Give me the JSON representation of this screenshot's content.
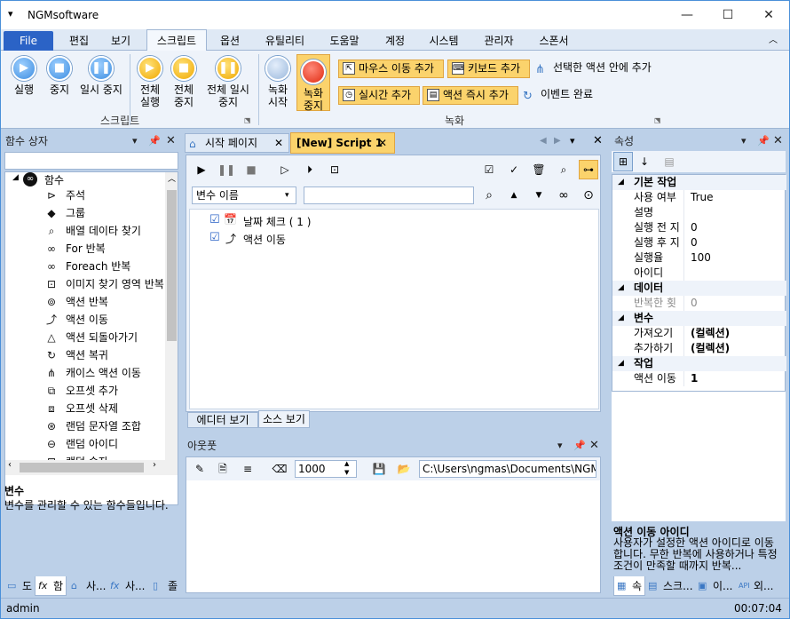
{
  "window": {
    "title": "NGMsoftware"
  },
  "menu": {
    "file": "File",
    "items": [
      "편집",
      "보기",
      "스크립트",
      "옵션",
      "유틸리티",
      "도움말",
      "계정",
      "시스템",
      "관리자",
      "스폰서"
    ]
  },
  "ribbon": {
    "run": "실행",
    "stop": "중지",
    "pause": "일시 중지",
    "run_all": "전체 실행",
    "stop_all": "전체 중지",
    "pause_all": "전체 일시 중지",
    "rec_start": "녹화 시작",
    "rec_stop": "녹화 중지",
    "mouse_move": "마우스 이동 추가",
    "keyboard": "키보드 추가",
    "in_action": "선택한 액션 안에 추가",
    "realtime": "실시간 추가",
    "action_now": "액션 즉시 추가",
    "event_done": "이벤트 완료",
    "group_script": "스크립트",
    "group_record": "녹화"
  },
  "left_panel": {
    "title": "함수 상자",
    "root": "함수",
    "items": [
      {
        "icon": "comment-icon",
        "label": "주석"
      },
      {
        "icon": "group-icon",
        "label": "그룹"
      },
      {
        "icon": "search-icon",
        "label": "배열 데이타 찾기"
      },
      {
        "icon": "infinity-icon",
        "label": "For 반복"
      },
      {
        "icon": "infinity-icon",
        "label": "Foreach 반복"
      },
      {
        "icon": "image-find-icon",
        "label": "이미지 찾기 영역 반복"
      },
      {
        "icon": "loop-icon",
        "label": "액션 반복"
      },
      {
        "icon": "jump-icon",
        "label": "액션 이동"
      },
      {
        "icon": "back-icon",
        "label": "액션 되돌아가기"
      },
      {
        "icon": "restore-icon",
        "label": "액션 복귀"
      },
      {
        "icon": "case-icon",
        "label": "캐이스 액션 이동"
      },
      {
        "icon": "offset-add-icon",
        "label": "오프셋 추가"
      },
      {
        "icon": "offset-delete-icon",
        "label": "오프셋 삭제"
      },
      {
        "icon": "random-string-icon",
        "label": "랜덤 문자열 조합"
      },
      {
        "icon": "random-id-icon",
        "label": "랜덤 아이디"
      },
      {
        "icon": "random-number-icon",
        "label": "랜덤 숫자"
      }
    ],
    "desc_title": "변수",
    "desc_text": "변수를 관리할 수 있는 함수들입니다.",
    "bottom_tabs": [
      "도",
      "함",
      "사...",
      "사...",
      "졸"
    ]
  },
  "editor": {
    "tabs": [
      {
        "label": "시작 페이지"
      },
      {
        "label": "[New] Script 1"
      }
    ],
    "var_select": "변수 이름",
    "tree": [
      {
        "label": "날짜 체크 ( 1 )"
      },
      {
        "label": "액션 이동"
      }
    ],
    "bottom_tabs": [
      "에디터 보기",
      "소스 보기"
    ]
  },
  "output": {
    "title": "아웃풋",
    "number": "1000",
    "path": "C:\\Users\\ngmas\\Documents\\NGM6\\"
  },
  "properties": {
    "title": "속성",
    "categories": [
      {
        "name": "기본 작업",
        "rows": [
          {
            "k": "사용 여부",
            "v": "True"
          },
          {
            "k": "설명",
            "v": ""
          },
          {
            "k": "실행 전 지",
            "v": "0"
          },
          {
            "k": "실행 후 지",
            "v": "0"
          },
          {
            "k": "실행율",
            "v": "100"
          },
          {
            "k": "아이디",
            "v": ""
          }
        ]
      },
      {
        "name": "데이터",
        "rows": [
          {
            "k": "반복한 횟",
            "v": "0"
          }
        ]
      },
      {
        "name": "변수",
        "rows": [
          {
            "k": "가져오기",
            "v": "(컬렉션)"
          },
          {
            "k": "추가하기",
            "v": "(컬렉션)"
          }
        ]
      },
      {
        "name": "작업",
        "rows": [
          {
            "k": "액션 이동",
            "v": "1"
          }
        ]
      }
    ],
    "desc_title": "액션 이동 아이디",
    "desc_text": "사용자가 설정한 액션 아이디로 이동합니다. 무한 반복에 사용하거나 특정 조건이 만족할 때까지 반복...",
    "bottom_tabs": [
      "속",
      "스크...",
      "이...",
      "외..."
    ]
  },
  "status": {
    "user": "admin",
    "time": "00:07:04"
  },
  "colors": {
    "accent": "#2b63c6",
    "highlight": "#fbd36c",
    "panel": "#bcd0e8"
  }
}
